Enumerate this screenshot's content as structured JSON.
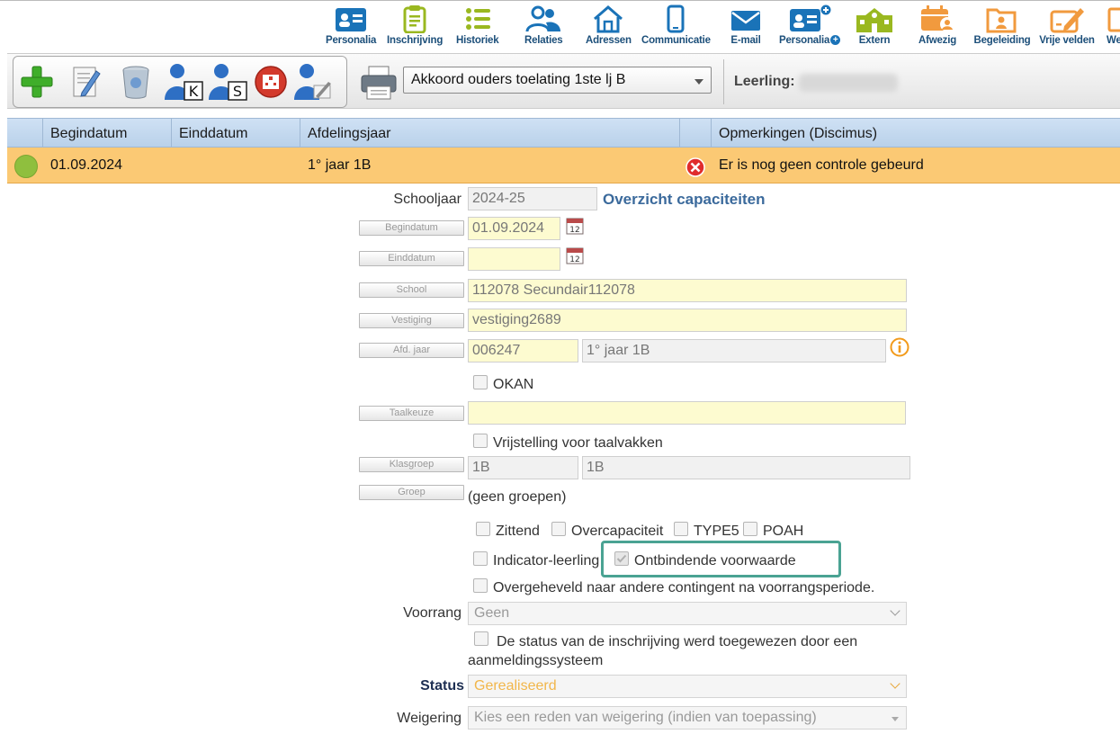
{
  "nav": {
    "items": [
      {
        "label": "Personalia",
        "icon": "id-card-icon"
      },
      {
        "label": "Inschrijving",
        "icon": "clipboard-icon"
      },
      {
        "label": "Historiek",
        "icon": "list-icon"
      },
      {
        "label": "Relaties",
        "icon": "people-icon"
      },
      {
        "label": "Adressen",
        "icon": "house-icon"
      },
      {
        "label": "Communicatie",
        "icon": "phone-icon"
      },
      {
        "label": "E-mail",
        "icon": "envelope-icon"
      },
      {
        "label": "Personalia",
        "icon": "id-card-plus-icon"
      },
      {
        "label": "Extern",
        "icon": "school-icon"
      },
      {
        "label": "Afwezig",
        "icon": "calendar-person-icon"
      },
      {
        "label": "Begeleiding",
        "icon": "folder-person-icon"
      },
      {
        "label": "Vrije velden",
        "icon": "pencil-edit-icon"
      },
      {
        "label": "We",
        "icon": "cut-off-icon"
      }
    ],
    "colors": {
      "blue": "#1a73b8",
      "green": "#9ab820",
      "orange": "#f19a3e",
      "label": "#1c4f7a"
    }
  },
  "toolbar": {
    "tools": [
      "add-icon",
      "edit-icon",
      "delete-bin-icon",
      "person-k-icon",
      "person-s-icon",
      "hospital-icon",
      "person-edit-icon"
    ],
    "tool_letters": {
      "k": "K",
      "s": "S"
    },
    "report_selected": "Akkoord ouders toelating 1ste lj B",
    "leerling_label": "Leerling:"
  },
  "grid": {
    "headers": [
      "Begindatum",
      "Einddatum",
      "Afdelingsjaar",
      "Opmerkingen (Discimus)"
    ],
    "row": {
      "status_color": "#8fbf3e",
      "begindatum": "01.09.2024",
      "einddatum": "",
      "afdelingsjaar": "1° jaar 1B",
      "opmerking": "Er is nog geen controle gebeurd"
    }
  },
  "form": {
    "schooljaar_label": "Schooljaar",
    "schooljaar_value": "2024-25",
    "capaciteit_link": "Overzicht capaciteiten",
    "begindatum_label": "Begindatum",
    "begindatum_value": "01.09.2024",
    "einddatum_label": "Einddatum",
    "einddatum_value": "",
    "school_label": "School",
    "school_value": "112078 Secundair112078",
    "vestiging_label": "Vestiging",
    "vestiging_value": "vestiging2689",
    "afdjaar_label": "Afd. jaar",
    "afdjaar_code": "006247",
    "afdjaar_name": "1° jaar 1B",
    "okan": "OKAN",
    "taalkeuze_label": "Taalkeuze",
    "taalkeuze_value": "",
    "vrijstelling": "Vrijstelling voor taalvakken",
    "klasgroep_label": "Klasgroep",
    "klasgroep_code": "1B",
    "klasgroep_name": "1B",
    "groep_label": "Groep",
    "groep_value": "(geen groepen)",
    "zittend": "Zittend",
    "overcapaciteit": "Overcapaciteit",
    "type5": "TYPE5",
    "poah": "POAH",
    "indicator": "Indicator-leerling",
    "ontbindende": "Ontbindende voorwaarde",
    "overgeheveld": "Overgeheveld naar andere contingent na voorrangsperiode.",
    "voorrang_label": "Voorrang",
    "voorrang_value": "Geen",
    "status_toegewezen_line1": "De status van de inschrijving werd toegewezen door een",
    "status_toegewezen_line2": "aanmeldingssysteem",
    "status_label": "Status",
    "status_value": "Gerealiseerd",
    "weigering_label": "Weigering",
    "weigering_value": "Kies een reden van weigering (indien van toepassing)",
    "highlight_color": "#4aa393"
  }
}
